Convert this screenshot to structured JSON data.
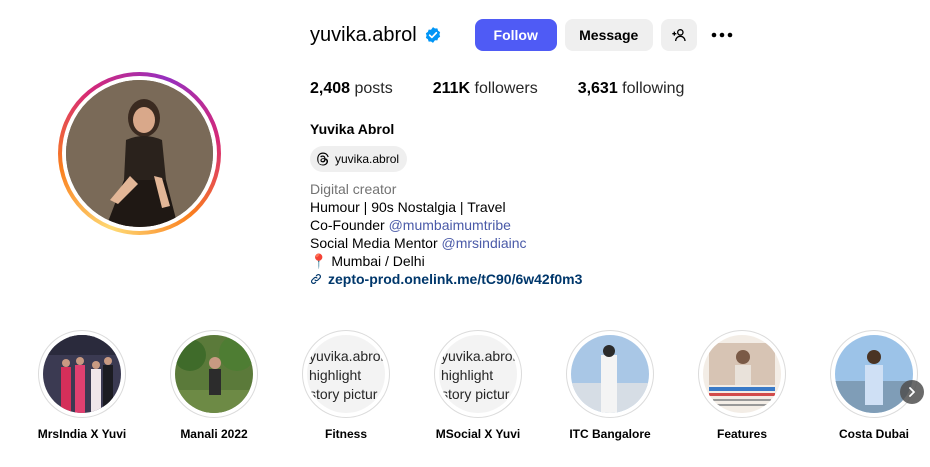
{
  "profile": {
    "username": "yuvika.abrol",
    "full_name": "Yuvika Abrol",
    "threads_handle": "yuvika.abrol",
    "category": "Digital creator",
    "bio_line1": "Humour | 90s Nostalgia | Travel",
    "bio_line2_prefix": "Co-Founder ",
    "bio_line2_mention": "@mumbaimumtribe",
    "bio_line3_prefix": "Social Media Mentor ",
    "bio_line3_mention": "@mrsindiainc",
    "location_emoji": "📍",
    "location": " Mumbai / Delhi",
    "link": "zepto-prod.onelink.me/tC90/6w42f0m3"
  },
  "actions": {
    "follow_label": "Follow",
    "message_label": "Message"
  },
  "stats": {
    "posts_count": "2,408",
    "posts_label": " posts",
    "followers_count": "211K",
    "followers_label": " followers",
    "following_count": "3,631",
    "following_label": " following"
  },
  "highlights": [
    {
      "label": "MrsIndia X Yuvi"
    },
    {
      "label": "Manali 2022"
    },
    {
      "label": "Fitness",
      "alt": "yuvika.abrol highlight story picture"
    },
    {
      "label": "MSocial X Yuvi",
      "alt": "yuvika.abrol highlight story picture"
    },
    {
      "label": "ITC Bangalore"
    },
    {
      "label": "Features"
    },
    {
      "label": "Costa Dubai"
    }
  ],
  "highlight_alt_lines": [
    "yuvika.abrol",
    "highlight",
    "story pictur"
  ],
  "colors": {
    "follow_button": "#4f5bf5",
    "verified_badge": "#0095f6",
    "mention": "#4a5aa8",
    "link": "#00376b"
  }
}
